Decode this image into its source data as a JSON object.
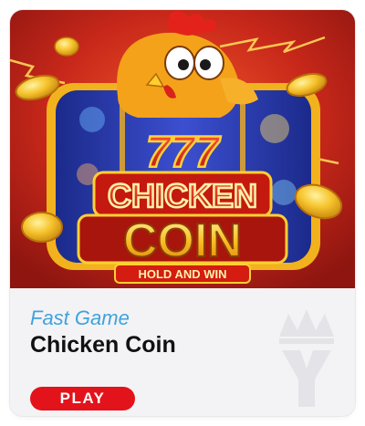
{
  "game": {
    "category": "Fast Game",
    "title": "Chicken Coin",
    "play_label": "PLAY"
  },
  "artwork": {
    "logo_top": "777",
    "logo_line1": "CHICKEN",
    "logo_line2": "COIN",
    "logo_ribbon": "HOLD AND WIN"
  },
  "colors": {
    "accent": "#e3131b",
    "category_text": "#3fa3dd",
    "art_background": "#c8281a",
    "gold": "#f6c32c"
  },
  "icons": [
    "crown-watermark-icon",
    "chicken-mascot-icon",
    "gold-coin-icon",
    "lightning-icon"
  ]
}
